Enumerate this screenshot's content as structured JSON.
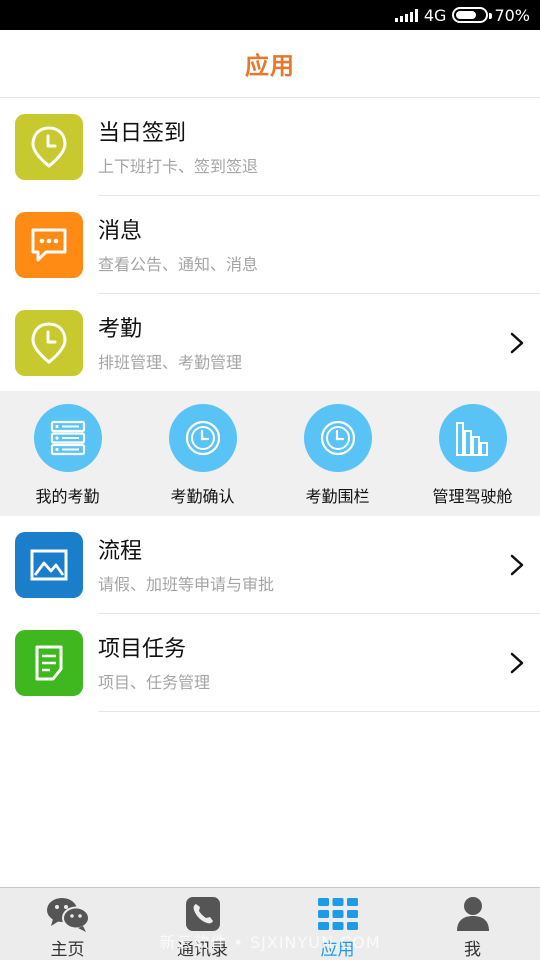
{
  "status_bar": {
    "network": "4G",
    "battery": "70%",
    "battery_level": 0.7
  },
  "header": {
    "title": "应用"
  },
  "list_top": [
    {
      "title": "当日签到",
      "subtitle": "上下班打卡、签到签退",
      "icon": "location-clock-icon",
      "color": "#c8c92f",
      "has_arrow": false
    },
    {
      "title": "消息",
      "subtitle": "查看公告、通知、消息",
      "icon": "message-icon",
      "color": "#ff8a14",
      "has_arrow": false
    },
    {
      "title": "考勤",
      "subtitle": "排班管理、考勤管理",
      "icon": "location-clock-icon",
      "color": "#c8c92f",
      "has_arrow": true
    }
  ],
  "quick_grid": [
    {
      "label": "我的考勤",
      "icon": "server-stack-icon"
    },
    {
      "label": "考勤确认",
      "icon": "clock-icon"
    },
    {
      "label": "考勤围栏",
      "icon": "clock-icon"
    },
    {
      "label": "管理驾驶舱",
      "icon": "bar-chart-icon"
    }
  ],
  "quick_grid_color": "#5ac3f5",
  "list_bottom": [
    {
      "title": "流程",
      "subtitle": "请假、加班等申请与审批",
      "icon": "image-frame-icon",
      "color": "#1a7ecb",
      "has_arrow": true
    },
    {
      "title": "项目任务",
      "subtitle": "项目、任务管理",
      "icon": "document-edit-icon",
      "color": "#3fb71f",
      "has_arrow": true
    }
  ],
  "bottom_nav": [
    {
      "label": "主页",
      "icon": "chat-bubbles-icon",
      "active": false
    },
    {
      "label": "通讯录",
      "icon": "phone-icon",
      "active": false
    },
    {
      "label": "应用",
      "icon": "grid-icon",
      "active": true
    },
    {
      "label": "我",
      "icon": "person-icon",
      "active": false
    }
  ],
  "watermark": "新云软件 • SJXINYUN.COM",
  "accent_color": "#e8762b",
  "active_nav_color": "#1e9be6"
}
